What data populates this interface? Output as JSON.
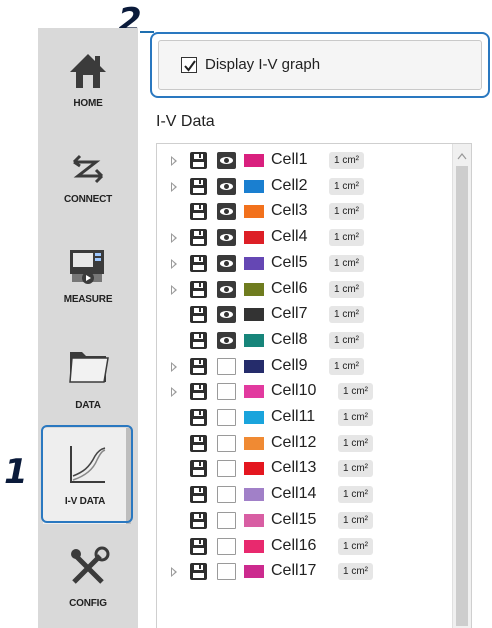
{
  "callouts": {
    "one": "1",
    "two": "2"
  },
  "sidebar": {
    "items": [
      {
        "label": "HOME",
        "icon": "home-icon"
      },
      {
        "label": "CONNECT",
        "icon": "connect-icon"
      },
      {
        "label": "MEASURE",
        "icon": "measure-icon"
      },
      {
        "label": "DATA",
        "icon": "folder-icon"
      },
      {
        "label": "I-V DATA",
        "icon": "iv-curve-icon",
        "active": true
      },
      {
        "label": "CONFIG",
        "icon": "config-tools-icon"
      }
    ]
  },
  "display_graph": {
    "label": "Display I-V graph",
    "checked": true
  },
  "section_title": "I-V Data",
  "cells": [
    {
      "name": "Cell1",
      "area": "1 cm²",
      "color": "#d9207e",
      "visible": true,
      "expandable": true
    },
    {
      "name": "Cell2",
      "area": "1 cm²",
      "color": "#1a7fd0",
      "visible": true,
      "expandable": true
    },
    {
      "name": "Cell3",
      "area": "1 cm²",
      "color": "#f2711c",
      "visible": true,
      "expandable": false
    },
    {
      "name": "Cell4",
      "area": "1 cm²",
      "color": "#dd1f26",
      "visible": true,
      "expandable": true
    },
    {
      "name": "Cell5",
      "area": "1 cm²",
      "color": "#6547b4",
      "visible": true,
      "expandable": true
    },
    {
      "name": "Cell6",
      "area": "1 cm²",
      "color": "#6f7c1f",
      "visible": true,
      "expandable": true
    },
    {
      "name": "Cell7",
      "area": "1 cm²",
      "color": "#333333",
      "visible": true,
      "expandable": false
    },
    {
      "name": "Cell8",
      "area": "1 cm²",
      "color": "#17857a",
      "visible": true,
      "expandable": false
    },
    {
      "name": "Cell9",
      "area": "1 cm²",
      "color": "#252c6b",
      "visible": false,
      "expandable": true
    },
    {
      "name": "Cell10",
      "area": "1 cm²",
      "color": "#e23a9f",
      "visible": false,
      "expandable": true
    },
    {
      "name": "Cell11",
      "area": "1 cm²",
      "color": "#1aa4dc",
      "visible": false,
      "expandable": false
    },
    {
      "name": "Cell12",
      "area": "1 cm²",
      "color": "#f08a33",
      "visible": false,
      "expandable": false
    },
    {
      "name": "Cell13",
      "area": "1 cm²",
      "color": "#e4161f",
      "visible": false,
      "expandable": false
    },
    {
      "name": "Cell14",
      "area": "1 cm²",
      "color": "#a180c8",
      "visible": false,
      "expandable": false
    },
    {
      "name": "Cell15",
      "area": "1 cm²",
      "color": "#d85ea3",
      "visible": false,
      "expandable": false
    },
    {
      "name": "Cell16",
      "area": "1 cm²",
      "color": "#e8296e",
      "visible": false,
      "expandable": false
    },
    {
      "name": "Cell17",
      "area": "1 cm²",
      "color": "#cc2a8e",
      "visible": false,
      "expandable": true
    }
  ]
}
